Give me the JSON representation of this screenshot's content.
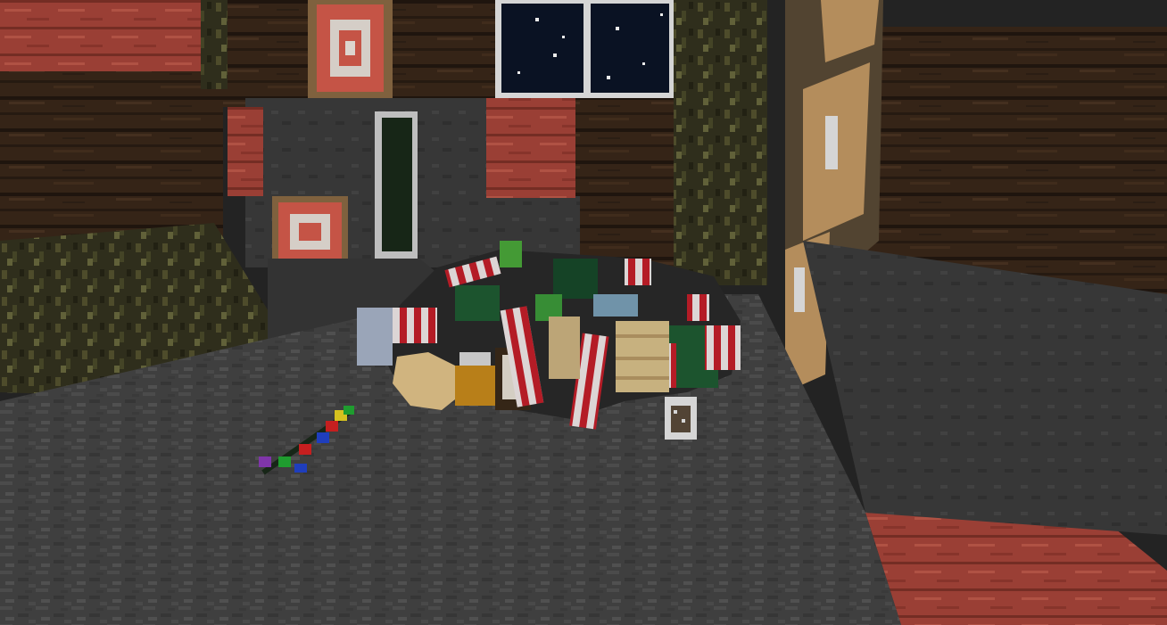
{
  "scene": {
    "game": "Minecraft",
    "view": "first-person",
    "hud_visible": false,
    "objects": [
      "stone-floor",
      "dark-oak-plank-wall",
      "red-terracotta-block",
      "spruce-log-pillar",
      "glass-window-night",
      "item-frame-target",
      "lectern-side",
      "christmas-item-pile",
      "candy-cane-items",
      "gift-box-items",
      "cookie-item",
      "honey-jar-item",
      "christmas-lights-string",
      "calendar-paper-item"
    ]
  },
  "palette": {
    "floor": "#4a4a4a",
    "floor_dark": "#3a3a3a",
    "plank": "#3b2a1c",
    "plank_dark": "#2a1d13",
    "terracotta": "#b24a3a",
    "log": "#3a3a24",
    "night_sky": "#0b1426",
    "candy_red": "#c8202c",
    "candy_white": "#f0ecec",
    "gift_green": "#1f5c32",
    "cookie": "#e2c48a",
    "honey": "#c88a1c"
  }
}
